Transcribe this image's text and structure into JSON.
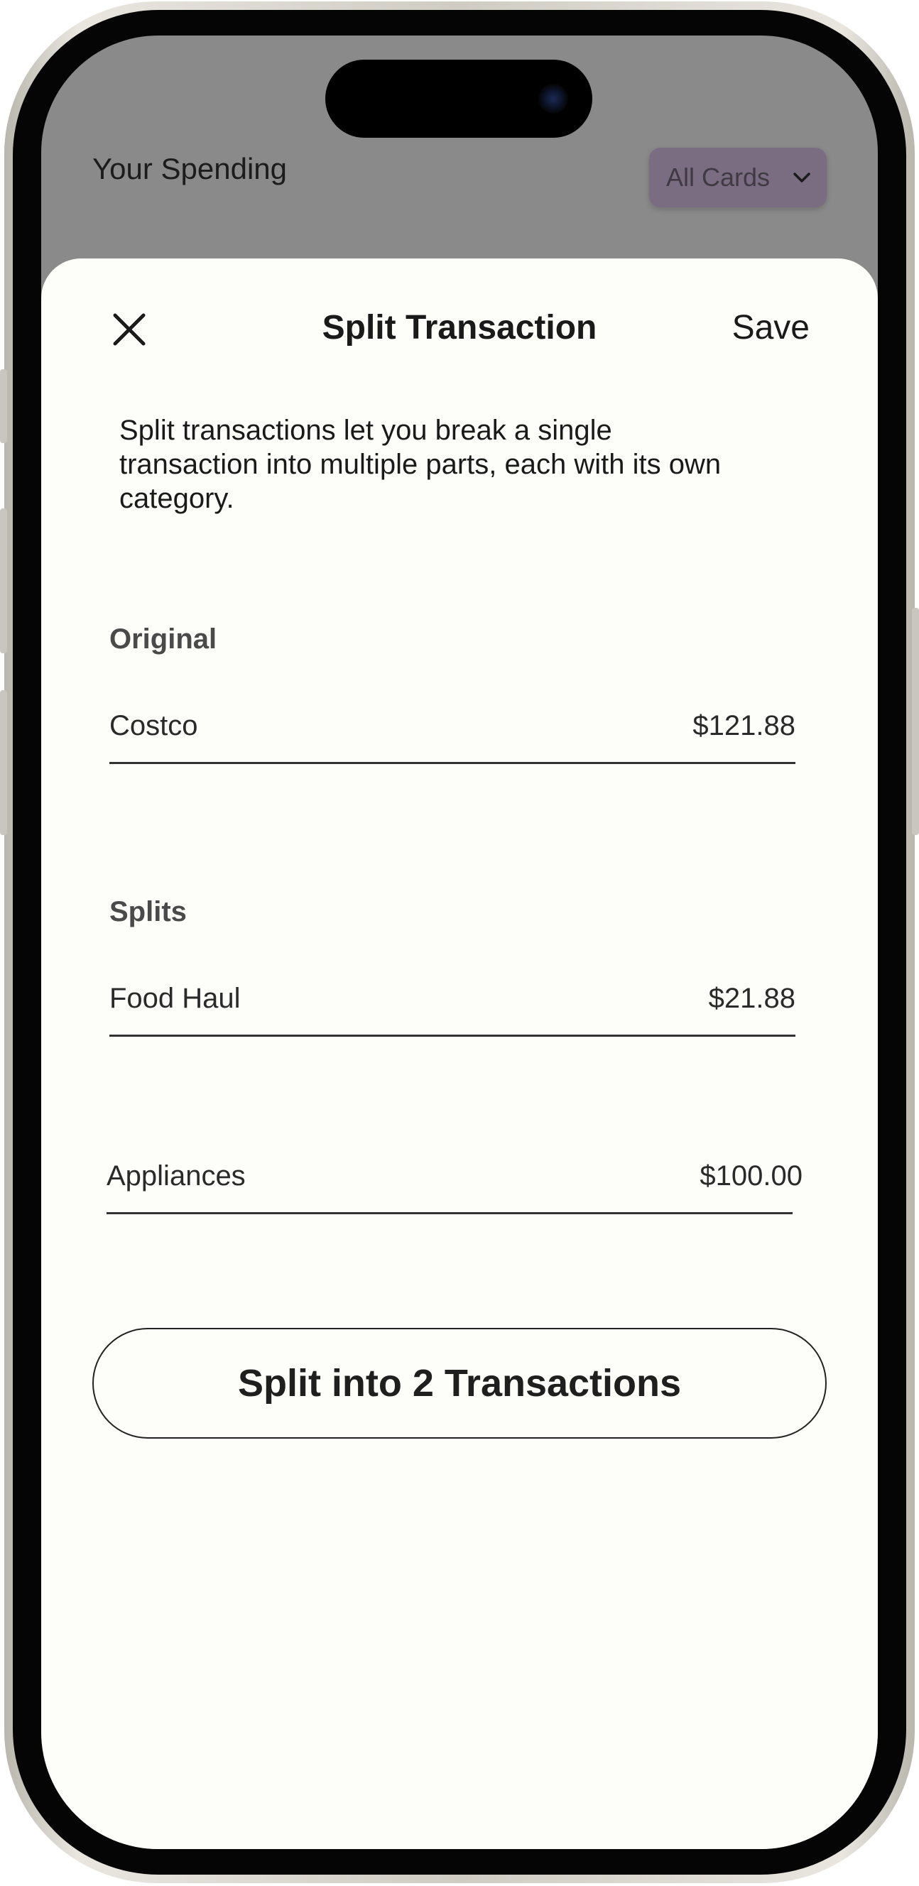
{
  "background": {
    "title": "Your Spending",
    "card_filter": {
      "selected": "All Cards",
      "icon": "chevron-down-icon"
    }
  },
  "sheet": {
    "close_icon": "close-icon",
    "title": "Split Transaction",
    "save_label": "Save",
    "description": "Split transactions let you break a single transaction into multiple parts, each with its own category.",
    "original": {
      "label": "Original",
      "name": "Costco",
      "amount": "$121.88"
    },
    "splits": {
      "label": "Splits",
      "items": [
        {
          "name": "Food Haul",
          "amount": "$21.88"
        },
        {
          "name": "Appliances",
          "amount": "$100.00"
        }
      ]
    },
    "split_button_label": "Split into 2 Transactions"
  },
  "colors": {
    "sheet_background": "#fdfdf9",
    "dimmed_background": "#8a8a8a",
    "card_filter_background": "#7a6d82",
    "text": "#1a1a1a"
  }
}
